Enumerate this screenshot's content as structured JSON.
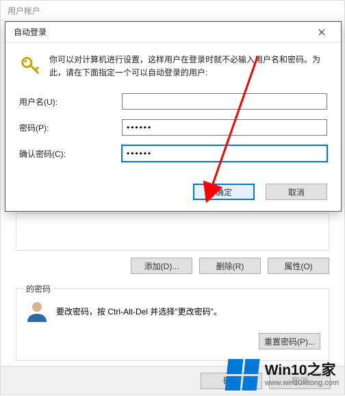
{
  "parent": {
    "title": "用户帐户",
    "add_button": "添加(D)...",
    "delete_button": "删除(R)",
    "properties_button": "属性(O)",
    "pwd_legend": "的密码",
    "pwd_hint": "要改密码，按 Ctrl-Alt-Del 并选择\"更改密码\"。",
    "reset_pwd_button": "重置密码(P)...",
    "footer_ok": "确定",
    "footer_cancel": "取消"
  },
  "dialog": {
    "title": "自动登录",
    "description": "你可以对计算机进行设置，这样用户在登录时就不必输入用户名和密码。为此，请在下面指定一个可以自动登录的用户:",
    "username_label": "用户名(U):",
    "username_value": "",
    "password_label": "密码(P):",
    "password_value": "••••••",
    "confirm_label": "确认密码(C):",
    "confirm_value": "••••••",
    "ok": "确定",
    "cancel": "取消"
  },
  "icons": {
    "keys": "keys-icon",
    "user": "user-icon",
    "close": "close-icon"
  },
  "watermark": {
    "brand": "Win10之家",
    "url": "www.win10xitong.com"
  },
  "colors": {
    "accent": "#0078d7",
    "annotation": "#ff0000"
  }
}
